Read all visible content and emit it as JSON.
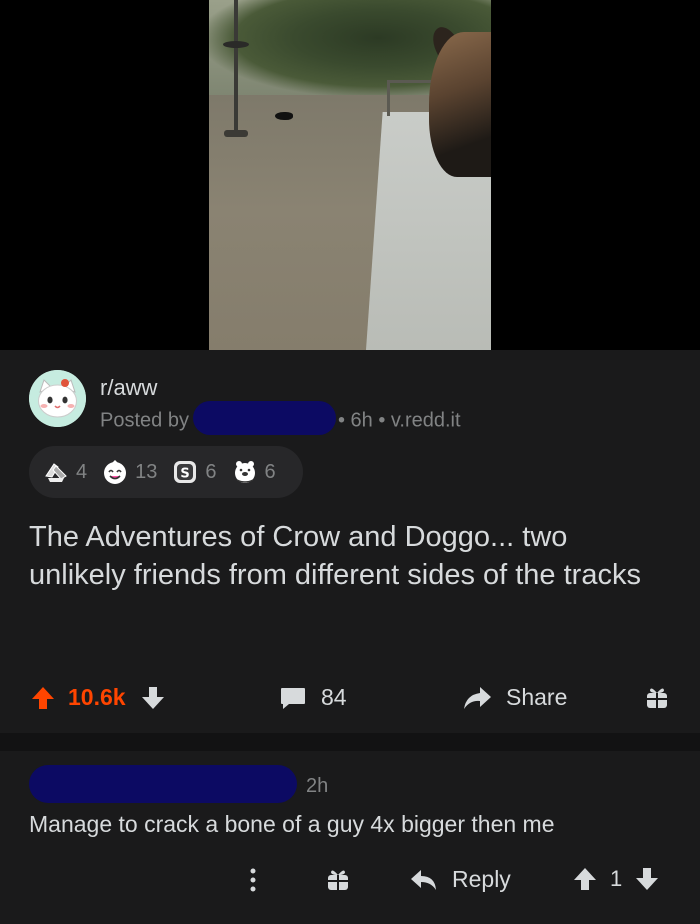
{
  "post": {
    "subreddit": "r/aww",
    "posted_by_label": "Posted by",
    "time_domain": "• 6h • v.redd.it",
    "title": "The Adventures of Crow and Doggo... two unlikely friends from different sides of the tracks",
    "awards": [
      {
        "icon": "hands-award-icon",
        "count": "4"
      },
      {
        "icon": "wholesome-award-icon",
        "count": "13"
      },
      {
        "icon": "silver-award-icon",
        "count": "6"
      },
      {
        "icon": "bear-hug-award-icon",
        "count": "6"
      }
    ],
    "score": "10.6k",
    "comments": "84",
    "share_label": "Share"
  },
  "comment": {
    "time": "2h",
    "body": "Manage to crack a bone of a guy 4x bigger then me",
    "reply_label": "Reply",
    "vote_count": "1"
  },
  "colors": {
    "background": "#1a1a1b",
    "upvote": "#ff4500",
    "redaction": "#0c0a63",
    "muted_text": "#818384"
  }
}
